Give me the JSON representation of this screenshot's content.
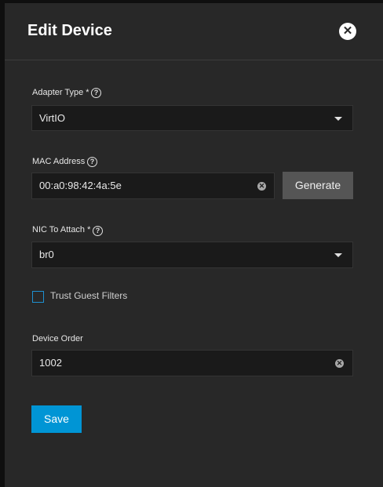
{
  "dialog": {
    "title": "Edit Device",
    "close_icon": "close-icon"
  },
  "adapter_type": {
    "label": "Adapter Type",
    "required_mark": "*",
    "value": "VirtIO"
  },
  "mac_address": {
    "label": "MAC Address",
    "value": "00:a0:98:42:4a:5e",
    "generate_label": "Generate"
  },
  "nic_to_attach": {
    "label": "NIC To Attach",
    "required_mark": "*",
    "value": "br0"
  },
  "trust_guest_filters": {
    "label": "Trust Guest Filters",
    "checked": false
  },
  "device_order": {
    "label": "Device Order",
    "value": "1002"
  },
  "actions": {
    "save_label": "Save"
  },
  "colors": {
    "panel_bg": "#282828",
    "field_bg": "#1a1a1a",
    "primary": "#0095d5",
    "secondary_button": "#555555"
  }
}
